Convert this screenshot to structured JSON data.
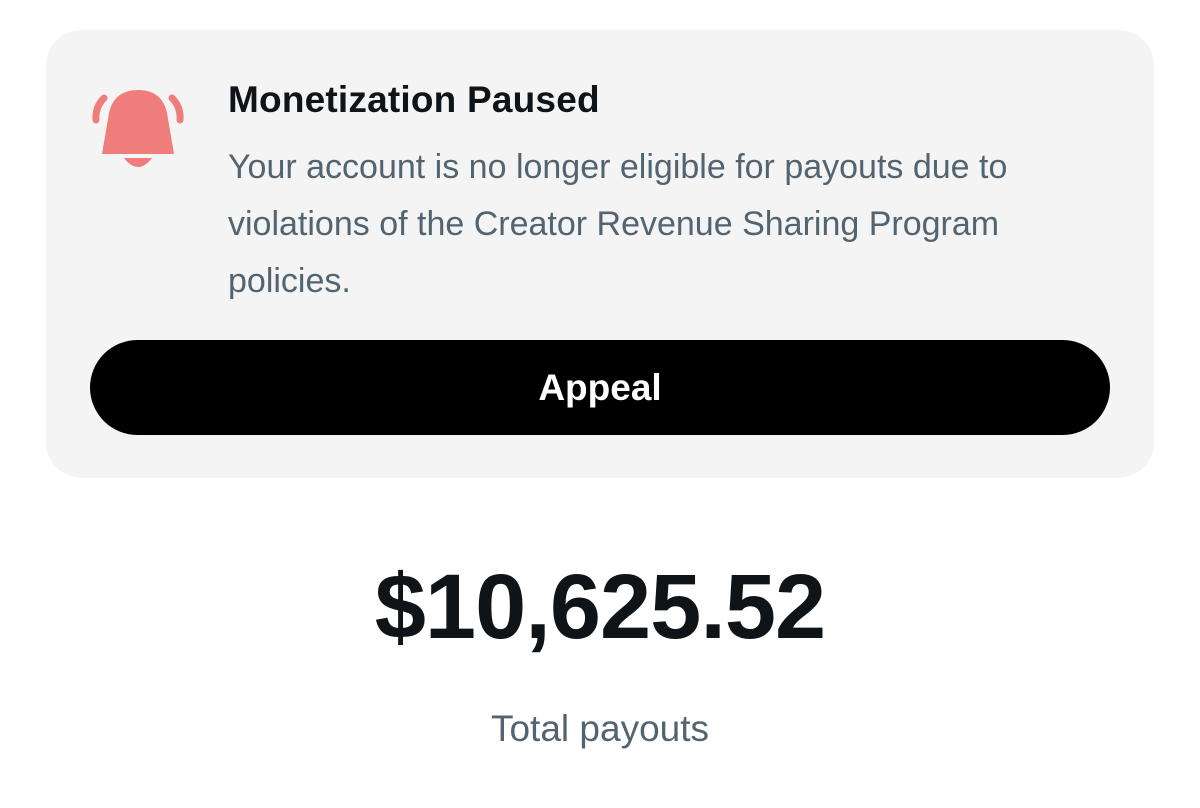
{
  "alert": {
    "title": "Monetization Paused",
    "message": "Your account is no longer eligible for payouts due to violations of the Creator Revenue Sharing Program policies.",
    "icon": "bell-ringing-icon",
    "icon_color": "#ef7d7b",
    "background": "#f4f4f4"
  },
  "actions": {
    "appeal_label": "Appeal"
  },
  "payouts": {
    "amount": "$10,625.52",
    "label": "Total payouts"
  },
  "colors": {
    "primary_text": "#0f1419",
    "secondary_text": "#536471",
    "button_bg": "#000000",
    "button_text": "#ffffff"
  }
}
